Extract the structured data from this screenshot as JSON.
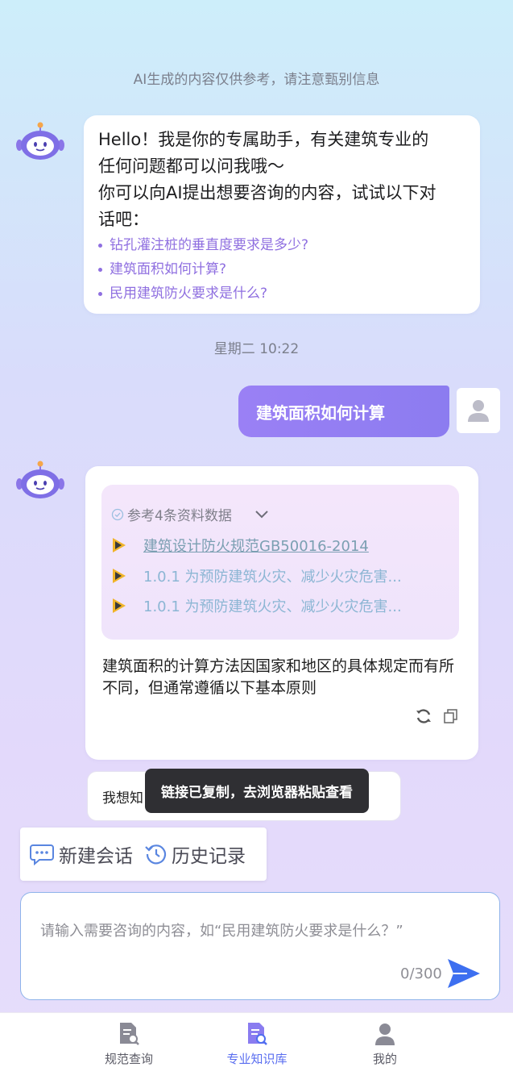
{
  "disclaimer": "AI生成的内容仅供参考，请注意甄别信息",
  "greeting": {
    "line1": "Hello！我是你的专属助手，有关建筑专业的",
    "line2": "任何问题都可以问我哦～",
    "line3": "你可以向AI提出想要咨询的内容，试试以下对",
    "line4": "话吧：",
    "suggestions": [
      "钻孔灌注桩的垂直度要求是多少?",
      "建筑面积如何计算?",
      "民用建筑防火要求是什么?"
    ]
  },
  "timestamp": "星期二 10:22",
  "user_message": "建筑面积如何计算",
  "answer": {
    "ref_header": "参考4条资料数据",
    "refs": [
      "建筑设计防火规范GB50016-2014",
      "1.0.1 为预防建筑火灾、减少火灾危害...",
      "1.0.1 为预防建筑火灾、减少火灾危害..."
    ],
    "text": "建筑面积的计算方法因国家和地区的具体规定而有所不同，但通常遵循以下基本原则"
  },
  "followup_prefix": "我想知",
  "toast": "链接已复制，去浏览器粘贴查看",
  "actions": {
    "new_chat": "新建会话",
    "history": "历史记录"
  },
  "input": {
    "placeholder": "请输入需要咨询的内容，如“民用建筑防火要求是什么？”",
    "counter": "0/300"
  },
  "tabs": [
    {
      "label": "规范查询",
      "icon": "document-search-icon"
    },
    {
      "label": "专业知识库",
      "icon": "knowledge-search-icon",
      "active": true
    },
    {
      "label": "我的",
      "icon": "profile-icon"
    }
  ],
  "colors": {
    "accent": "#8c7cf0",
    "link": "#7b9fb2",
    "suggestion": "#8f6fe0",
    "tab_active": "#5a6ef0"
  }
}
